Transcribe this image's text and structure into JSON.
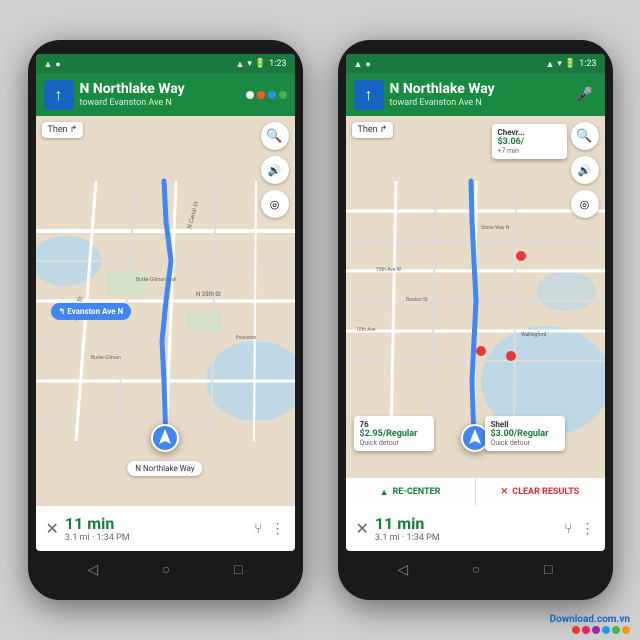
{
  "scene": {
    "background": "#d0d0d0"
  },
  "phone1": {
    "status": {
      "left": "▲ ♦",
      "signal": "▲ WiFi",
      "battery": "1:23"
    },
    "nav_header": {
      "direction": "↑",
      "street": "N Northlake Way",
      "toward": "toward Evanston Ave N",
      "dots_label": "options"
    },
    "then": "Then ↱",
    "map_location": "N Northlake Way",
    "turn_bubble": "↰ Evanston Ave N",
    "bottom": {
      "time": "11 min",
      "details": "3.1 mi · 1:34 PM"
    }
  },
  "phone2": {
    "status": {
      "left": "▲ ♦",
      "battery": "1:23"
    },
    "nav_header": {
      "direction": "↑",
      "street": "N Northlake Way",
      "toward": "toward Evanston Ave N",
      "mic": "🎤"
    },
    "then": "Then ↱",
    "gas_top": {
      "name": "Chevr...",
      "price": "$3.06/",
      "time": "+7 min"
    },
    "gas_bottom_left": {
      "name": "76",
      "price": "$2.95/Regular",
      "label": "Quick detour"
    },
    "gas_bottom_right": {
      "name": "Shell",
      "price": "$3.00/Regular",
      "label": "Quick detour"
    },
    "action_recenter": "RE-CENTER",
    "action_clear": "CLEAR RESULTS",
    "bottom": {
      "time": "11 min",
      "details": "3.1 mi · 1:34 PM"
    }
  },
  "watermark": {
    "text": "Download.com.vn",
    "dots": [
      "#e53935",
      "#e91e63",
      "#9c27b0",
      "#2196f3",
      "#4caf50",
      "#ff9800"
    ]
  }
}
